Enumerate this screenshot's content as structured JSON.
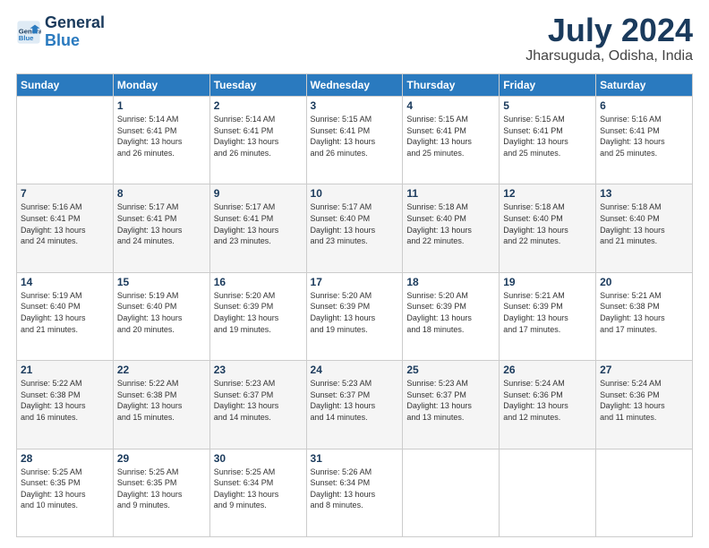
{
  "logo": {
    "line1": "General",
    "line2": "Blue"
  },
  "title": "July 2024",
  "location": "Jharsuguda, Odisha, India",
  "headers": [
    "Sunday",
    "Monday",
    "Tuesday",
    "Wednesday",
    "Thursday",
    "Friday",
    "Saturday"
  ],
  "weeks": [
    [
      {
        "day": "",
        "info": ""
      },
      {
        "day": "1",
        "info": "Sunrise: 5:14 AM\nSunset: 6:41 PM\nDaylight: 13 hours\nand 26 minutes."
      },
      {
        "day": "2",
        "info": "Sunrise: 5:14 AM\nSunset: 6:41 PM\nDaylight: 13 hours\nand 26 minutes."
      },
      {
        "day": "3",
        "info": "Sunrise: 5:15 AM\nSunset: 6:41 PM\nDaylight: 13 hours\nand 26 minutes."
      },
      {
        "day": "4",
        "info": "Sunrise: 5:15 AM\nSunset: 6:41 PM\nDaylight: 13 hours\nand 25 minutes."
      },
      {
        "day": "5",
        "info": "Sunrise: 5:15 AM\nSunset: 6:41 PM\nDaylight: 13 hours\nand 25 minutes."
      },
      {
        "day": "6",
        "info": "Sunrise: 5:16 AM\nSunset: 6:41 PM\nDaylight: 13 hours\nand 25 minutes."
      }
    ],
    [
      {
        "day": "7",
        "info": "Sunrise: 5:16 AM\nSunset: 6:41 PM\nDaylight: 13 hours\nand 24 minutes."
      },
      {
        "day": "8",
        "info": "Sunrise: 5:17 AM\nSunset: 6:41 PM\nDaylight: 13 hours\nand 24 minutes."
      },
      {
        "day": "9",
        "info": "Sunrise: 5:17 AM\nSunset: 6:41 PM\nDaylight: 13 hours\nand 23 minutes."
      },
      {
        "day": "10",
        "info": "Sunrise: 5:17 AM\nSunset: 6:40 PM\nDaylight: 13 hours\nand 23 minutes."
      },
      {
        "day": "11",
        "info": "Sunrise: 5:18 AM\nSunset: 6:40 PM\nDaylight: 13 hours\nand 22 minutes."
      },
      {
        "day": "12",
        "info": "Sunrise: 5:18 AM\nSunset: 6:40 PM\nDaylight: 13 hours\nand 22 minutes."
      },
      {
        "day": "13",
        "info": "Sunrise: 5:18 AM\nSunset: 6:40 PM\nDaylight: 13 hours\nand 21 minutes."
      }
    ],
    [
      {
        "day": "14",
        "info": "Sunrise: 5:19 AM\nSunset: 6:40 PM\nDaylight: 13 hours\nand 21 minutes."
      },
      {
        "day": "15",
        "info": "Sunrise: 5:19 AM\nSunset: 6:40 PM\nDaylight: 13 hours\nand 20 minutes."
      },
      {
        "day": "16",
        "info": "Sunrise: 5:20 AM\nSunset: 6:39 PM\nDaylight: 13 hours\nand 19 minutes."
      },
      {
        "day": "17",
        "info": "Sunrise: 5:20 AM\nSunset: 6:39 PM\nDaylight: 13 hours\nand 19 minutes."
      },
      {
        "day": "18",
        "info": "Sunrise: 5:20 AM\nSunset: 6:39 PM\nDaylight: 13 hours\nand 18 minutes."
      },
      {
        "day": "19",
        "info": "Sunrise: 5:21 AM\nSunset: 6:39 PM\nDaylight: 13 hours\nand 17 minutes."
      },
      {
        "day": "20",
        "info": "Sunrise: 5:21 AM\nSunset: 6:38 PM\nDaylight: 13 hours\nand 17 minutes."
      }
    ],
    [
      {
        "day": "21",
        "info": "Sunrise: 5:22 AM\nSunset: 6:38 PM\nDaylight: 13 hours\nand 16 minutes."
      },
      {
        "day": "22",
        "info": "Sunrise: 5:22 AM\nSunset: 6:38 PM\nDaylight: 13 hours\nand 15 minutes."
      },
      {
        "day": "23",
        "info": "Sunrise: 5:23 AM\nSunset: 6:37 PM\nDaylight: 13 hours\nand 14 minutes."
      },
      {
        "day": "24",
        "info": "Sunrise: 5:23 AM\nSunset: 6:37 PM\nDaylight: 13 hours\nand 14 minutes."
      },
      {
        "day": "25",
        "info": "Sunrise: 5:23 AM\nSunset: 6:37 PM\nDaylight: 13 hours\nand 13 minutes."
      },
      {
        "day": "26",
        "info": "Sunrise: 5:24 AM\nSunset: 6:36 PM\nDaylight: 13 hours\nand 12 minutes."
      },
      {
        "day": "27",
        "info": "Sunrise: 5:24 AM\nSunset: 6:36 PM\nDaylight: 13 hours\nand 11 minutes."
      }
    ],
    [
      {
        "day": "28",
        "info": "Sunrise: 5:25 AM\nSunset: 6:35 PM\nDaylight: 13 hours\nand 10 minutes."
      },
      {
        "day": "29",
        "info": "Sunrise: 5:25 AM\nSunset: 6:35 PM\nDaylight: 13 hours\nand 9 minutes."
      },
      {
        "day": "30",
        "info": "Sunrise: 5:25 AM\nSunset: 6:34 PM\nDaylight: 13 hours\nand 9 minutes."
      },
      {
        "day": "31",
        "info": "Sunrise: 5:26 AM\nSunset: 6:34 PM\nDaylight: 13 hours\nand 8 minutes."
      },
      {
        "day": "",
        "info": ""
      },
      {
        "day": "",
        "info": ""
      },
      {
        "day": "",
        "info": ""
      }
    ]
  ]
}
